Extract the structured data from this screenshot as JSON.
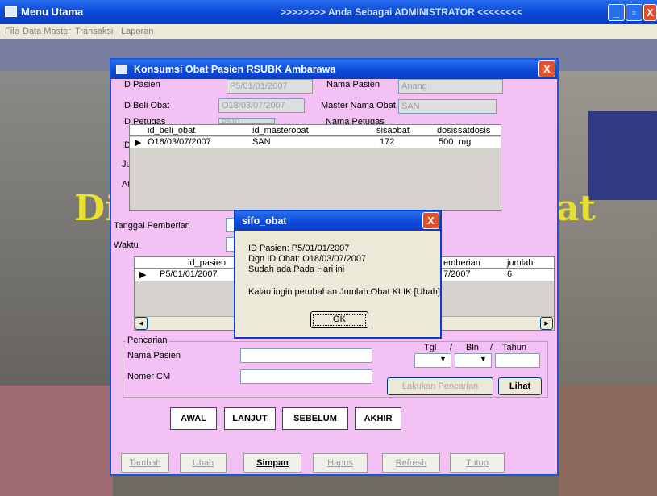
{
  "main_window": {
    "title": "Menu Utama",
    "role_banner": ">>>>>>>> Anda Sebagai ADMINISTRATOR <<<<<<<<",
    "minimize": "_",
    "maximize": "▫",
    "close": "X"
  },
  "menu": [
    "File",
    "Data Master",
    "Transaksi",
    "Laporan"
  ],
  "background": {
    "left_text": "Di",
    "right_text": "at"
  },
  "form": {
    "title": "Konsumsi Obat Pasien RSUBK Ambarawa",
    "close": "X",
    "id_pasien_label": "ID Pasien",
    "id_pasien_value": "P5/01/01/2007",
    "nama_pasien_label": "Nama Pasien",
    "nama_pasien_value": "Anang",
    "id_beli_obat_label": "ID Beli Obat",
    "id_beli_obat_value": "O18/03/07/2007",
    "master_nama_obat_label": "Master Nama Obat",
    "master_nama_obat_value": "SAN",
    "id_petugas_label": "ID Petugas",
    "id_petugas_value": "PS10",
    "nama_petugas_label": "Nama Petugas",
    "row4_label_fragment": "ID",
    "jumlah_label_fragment": "Jun",
    "aturan_label_fragment": "Atu",
    "tanggal_pemberian_label": "Tanggal Pemberian",
    "waktu_label": "Waktu"
  },
  "obat_grid": {
    "columns": [
      "id_beli_obat",
      "id_masterobat",
      "sisaobat",
      "dosis",
      "satdosis"
    ],
    "rows": [
      {
        "id_beli_obat": "O18/03/07/2007",
        "id_masterobat": "SAN",
        "sisaobat": "172",
        "dosis": "500",
        "satdosis": "mg"
      }
    ]
  },
  "pasien_grid": {
    "columns": [
      "id_pasien",
      "tgl_pemberian",
      "jumlah"
    ],
    "col_fragment": "emberian",
    "rows": [
      {
        "id_pasien": "P5/01/01/2007",
        "tgl_fragment": "7/2007",
        "jumlah": "6"
      }
    ],
    "scroll_left": "◂",
    "scroll_right": "▸"
  },
  "pencarian": {
    "group_label": "Pencarian",
    "nama_pasien_label": "Nama Pasien",
    "nomer_cm_label": "Nomer CM",
    "tgl_label": "Tgl",
    "sep1": "/",
    "bln_label": "Bln",
    "sep2": "/",
    "tahun_label": "Tahun",
    "search_button": "Lakukan Pencarian",
    "lihat_button": "Lihat"
  },
  "nav_buttons": {
    "awal": "AWAL",
    "lanjut": "LANJUT",
    "sebelum": "SEBELUM",
    "akhir": "AKHIR"
  },
  "bottom_buttons": {
    "tambah": "Tambah",
    "ubah": "Ubah",
    "simpan": "Simpan",
    "hapus": "Hapus",
    "refresh": "Refresh",
    "tutup": "Tutup"
  },
  "message_box": {
    "title": "sifo_obat",
    "line1": "ID Pasien: P5/01/01/2007",
    "line2": "Dgn ID Obat: O18/03/07/2007",
    "line3": "Sudah ada Pada Hari ini",
    "line4": "Kalau ingin perubahan Jumlah Obat KLIK [Ubah]",
    "ok": "OK",
    "close": "X"
  }
}
